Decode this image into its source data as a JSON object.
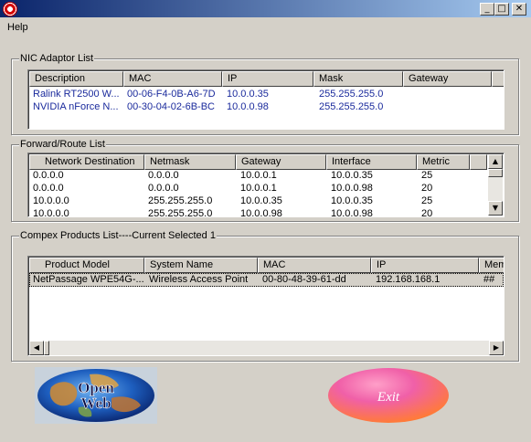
{
  "window": {
    "icon": "app-gear-icon",
    "minimize_glyph": "_",
    "maximize_glyph": "□",
    "close_glyph": "✕"
  },
  "menu": {
    "help_label": "Help"
  },
  "nic": {
    "group_label": "NIC Adaptor List",
    "columns": [
      "Description",
      "MAC",
      "IP",
      "Mask",
      "Gateway"
    ],
    "rows": [
      [
        "Ralink RT2500 W...",
        "00-06-F4-0B-A6-7D",
        "10.0.0.35",
        "255.255.255.0",
        ""
      ],
      [
        "NVIDIA nForce N...",
        "00-30-04-02-6B-BC",
        "10.0.0.98",
        "255.255.255.0",
        ""
      ]
    ]
  },
  "route": {
    "group_label": "Forward/Route List",
    "columns": [
      "Network Destination",
      "Netmask",
      "Gateway",
      "Interface",
      "Metric"
    ],
    "rows": [
      [
        "0.0.0.0",
        "0.0.0.0",
        "10.0.0.1",
        "10.0.0.35",
        "25"
      ],
      [
        "0.0.0.0",
        "0.0.0.0",
        "10.0.0.1",
        "10.0.0.98",
        "20"
      ],
      [
        "10.0.0.0",
        "255.255.255.0",
        "10.0.0.35",
        "10.0.0.35",
        "25"
      ],
      [
        "10.0.0.0",
        "255.255.255.0",
        "10.0.0.98",
        "10.0.0.98",
        "20"
      ]
    ]
  },
  "products": {
    "group_label": "Compex Products List----Current Selected 1",
    "columns": [
      "Product Model",
      "System Name",
      "MAC",
      "IP",
      "Mem"
    ],
    "rows": [
      [
        "NetPassage WPE54G-...",
        "Wireless Access Point",
        "00-80-48-39-61-dd",
        "192.168.168.1",
        "##"
      ]
    ]
  },
  "buttons": {
    "open_web_line1": "Open",
    "open_web_line2": "Web",
    "exit_label": "Exit"
  },
  "colors": {
    "title_start": "#0a246a",
    "title_end": "#a6caf0",
    "nic_text": "#1a2a9c",
    "exit_pink": "#f060a8"
  }
}
